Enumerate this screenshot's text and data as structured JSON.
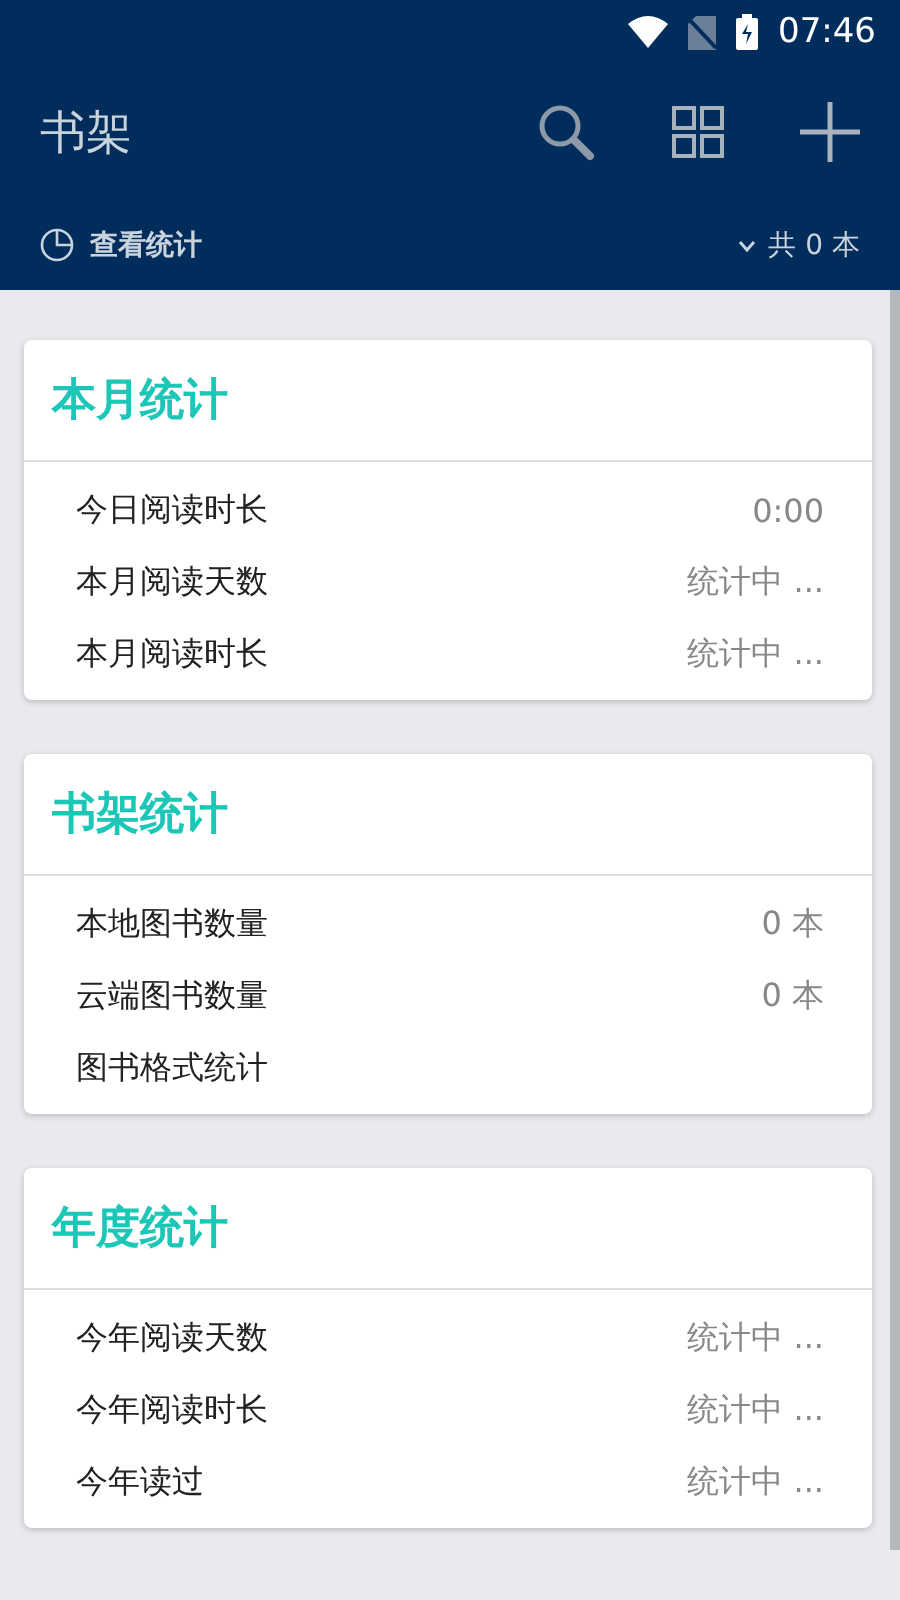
{
  "status_bar": {
    "time": "07:46"
  },
  "toolbar": {
    "title": "书架"
  },
  "sub_bar": {
    "stats_link": "查看统计",
    "count": "共 0 本"
  },
  "cards": [
    {
      "title": "本月统计",
      "rows": [
        {
          "label": "今日阅读时长",
          "value": "0:00"
        },
        {
          "label": "本月阅读天数",
          "value": "统计中 ..."
        },
        {
          "label": "本月阅读时长",
          "value": "统计中 ..."
        }
      ]
    },
    {
      "title": "书架统计",
      "rows": [
        {
          "label": "本地图书数量",
          "value": "0 本"
        },
        {
          "label": "云端图书数量",
          "value": "0 本"
        },
        {
          "label": "图书格式统计"
        }
      ]
    },
    {
      "title": "年度统计",
      "rows": [
        {
          "label": "今年阅读天数",
          "value": "统计中 ..."
        },
        {
          "label": "今年阅读时长",
          "value": "统计中 ..."
        },
        {
          "label": "今年读过",
          "value": "统计中 ..."
        }
      ]
    }
  ]
}
